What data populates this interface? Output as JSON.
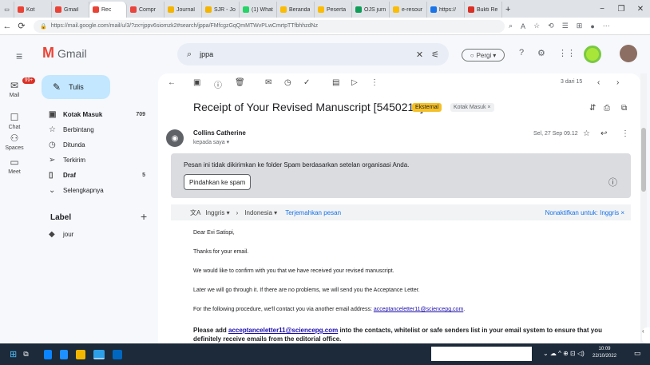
{
  "browser": {
    "tabs": [
      {
        "label": "Kot",
        "color": "#ea4335",
        "active": false
      },
      {
        "label": "Gmail",
        "color": "#ea4335",
        "active": false
      },
      {
        "label": "Rec",
        "color": "#ea4335",
        "active": true
      },
      {
        "label": "Compr",
        "color": "#e8453c",
        "active": false
      },
      {
        "label": "Journal",
        "color": "#f4b400",
        "active": false
      },
      {
        "label": "SJR - Jou",
        "color": "#f4b400",
        "active": false
      },
      {
        "label": "(1) What",
        "color": "#25d366",
        "active": false
      },
      {
        "label": "Beranda",
        "color": "#fbbc04",
        "active": false
      },
      {
        "label": "Peserta",
        "color": "#fbbc04",
        "active": false
      },
      {
        "label": "OJS jurn",
        "color": "#0f9d58",
        "active": false
      },
      {
        "label": "e-resour",
        "color": "#fbbc04",
        "active": false
      },
      {
        "label": "https://",
        "color": "#1a73e8",
        "active": false
      },
      {
        "label": "Bukti Re",
        "color": "#d93025",
        "active": false
      }
    ],
    "new_tab": "+",
    "win_controls": [
      "−",
      "❐",
      "✕"
    ],
    "url": "https://mail.google.com/mail/u/3/?zx=jppv6siomzk2#search/jppa/FMfcgzGqQmMTWvPLwCmrtpTTfbhhzdNz"
  },
  "gmail": {
    "logo_text": "Gmail",
    "search_value": "jppa",
    "status_label": "Pergi",
    "rail": [
      {
        "label": "Mail",
        "icon": "mail-icon",
        "glyph": "✉",
        "badge": "99+"
      },
      {
        "label": "Chat",
        "icon": "chat-icon",
        "glyph": "☐"
      },
      {
        "label": "Spaces",
        "icon": "spaces-icon",
        "glyph": "⚇"
      },
      {
        "label": "Meet",
        "icon": "meet-icon",
        "glyph": "▭"
      }
    ],
    "compose_label": "Tulis",
    "nav": [
      {
        "label": "Kotak Masuk",
        "icon": "inbox-icon",
        "glyph": "▣",
        "count": "709",
        "bold": true
      },
      {
        "label": "Berbintang",
        "icon": "star-icon",
        "glyph": "☆",
        "count": ""
      },
      {
        "label": "Ditunda",
        "icon": "snooze-icon",
        "glyph": "◷",
        "count": ""
      },
      {
        "label": "Terkirim",
        "icon": "sent-icon",
        "glyph": "➢",
        "count": ""
      },
      {
        "label": "Draf",
        "icon": "draft-icon",
        "glyph": "▯",
        "count": "5",
        "bold": true
      },
      {
        "label": "Selengkapnya",
        "icon": "chevron-down-icon",
        "glyph": "⌄",
        "count": ""
      }
    ],
    "labels_header": "Label",
    "labels": [
      {
        "label": "jour"
      }
    ]
  },
  "message": {
    "pager": "3 dari 15",
    "subject": "Receipt of Your Revised Manuscript [5450217]",
    "tag_external": "Eksternal",
    "tag_inbox": "Kotak Masuk ×",
    "sender_name": "Collins Catherine",
    "sender_to": "kepada saya ▾",
    "date": "Sel, 27 Sep 09.12",
    "spam_notice": "Pesan ini tidak dikirimkan ke folder Spam berdasarkan setelan organisasi Anda.",
    "spam_button": "Pindahkan ke spam",
    "translate_from": "Inggris ▾",
    "translate_to": "Indonesia ▾",
    "translate_link": "Terjemahkan pesan",
    "translate_off": "Nonaktifkan untuk: Inggris ×",
    "body": {
      "greeting": "Dear Evi Satispi,",
      "thanks": "Thanks for your email.",
      "confirm": "We would like to confirm with you that we have received your revised manuscript.",
      "later": "Later we will go through it. If there are no problems, we will send you the Acceptance Letter.",
      "procedure": "For the following procedure, we'll contact you via another email address: ",
      "procedure_email": "acceptanceletter11@sciencepg.com",
      "procedure_end": ".",
      "please_a": "Please add ",
      "please_email": "acceptanceletter11@sciencepg.com",
      "please_b": " into the contacts, whitelist or safe senders list in your email system to ensure that you definitely receive emails from the editorial office."
    }
  },
  "taskbar": {
    "tray": "⌄  ☁  ^  ⊕  ⊡  ◁)",
    "time": "10:09",
    "date": "22/10/2022"
  }
}
